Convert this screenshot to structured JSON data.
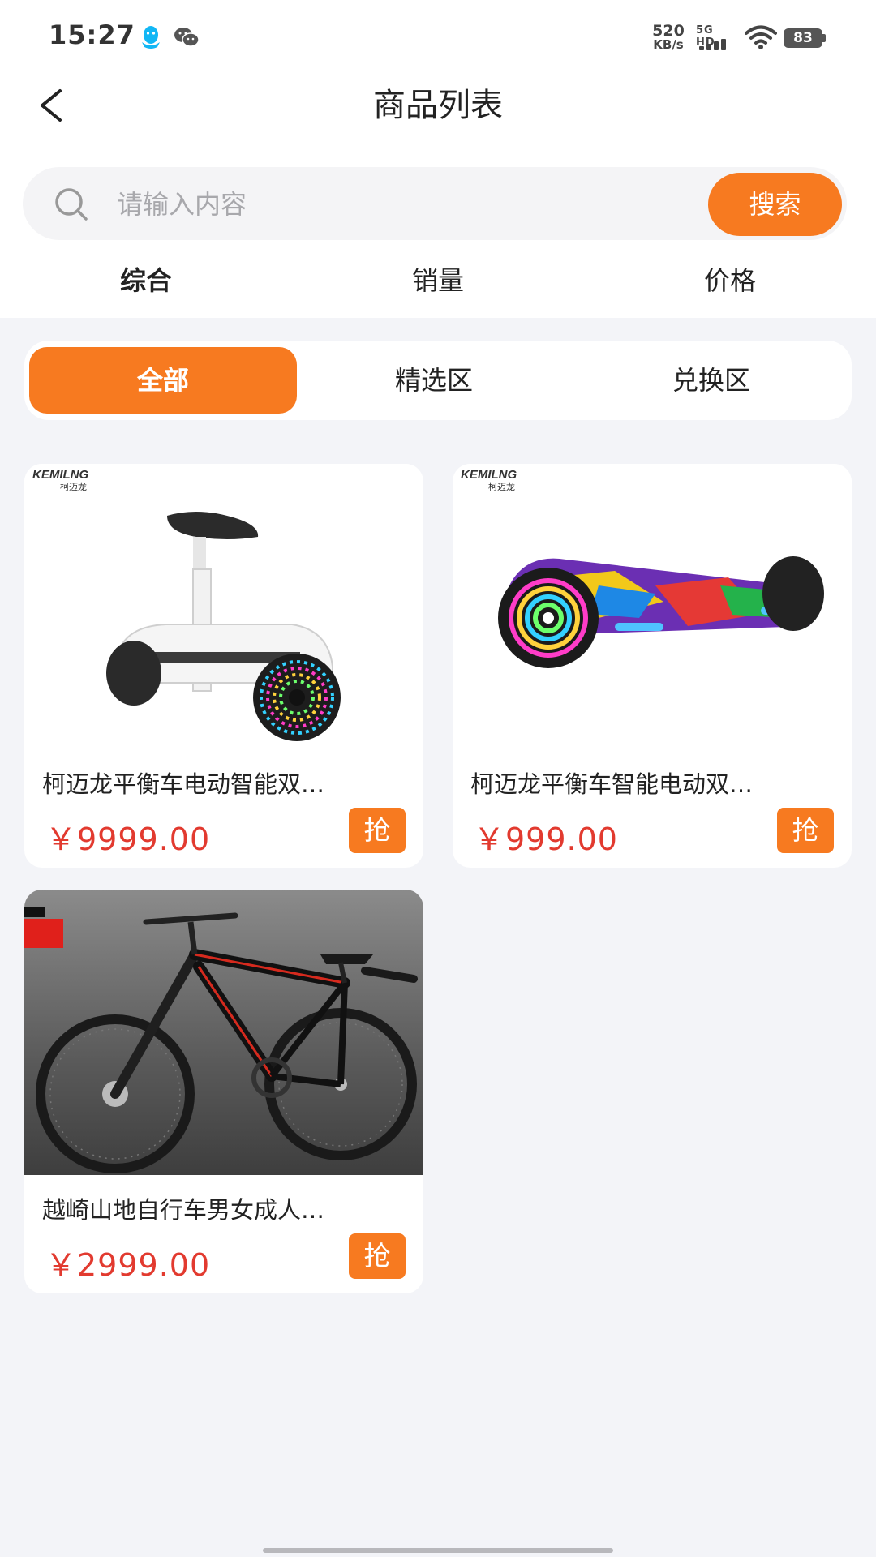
{
  "status_bar": {
    "time": "15:27",
    "net_speed_value": "520",
    "net_speed_unit": "KB/s",
    "network_label": "5G HD",
    "battery_level": "83",
    "icons": [
      "qq-icon",
      "wechat-icon",
      "signal-icon",
      "wifi-icon",
      "battery-icon"
    ]
  },
  "header": {
    "title": "商品列表",
    "back_icon": "chevron-left-icon"
  },
  "search": {
    "placeholder": "请输入内容",
    "value": "",
    "button_label": "搜索",
    "icon": "search-icon"
  },
  "sort_tabs": [
    {
      "label": "综合",
      "active": true
    },
    {
      "label": "销量",
      "active": false
    },
    {
      "label": "价格",
      "active": false
    }
  ],
  "segments": [
    {
      "label": "全部",
      "active": true
    },
    {
      "label": "精选区",
      "active": false
    },
    {
      "label": "兑换区",
      "active": false
    }
  ],
  "products": [
    {
      "name": "柯迈龙平衡车电动智能双…",
      "price": "￥9999.00",
      "buy_label": "抢",
      "image_brand": "KEMILNG 柯迈龙"
    },
    {
      "name": "柯迈龙平衡车智能电动双…",
      "price": "￥999.00",
      "buy_label": "抢",
      "image_brand": "KEMILNG 柯迈龙"
    },
    {
      "name": "越崎山地自行车男女成人…",
      "price": "￥2999.00",
      "buy_label": "抢",
      "image_brand": ""
    }
  ],
  "colors": {
    "accent": "#f77a20",
    "price": "#e23a2f",
    "background": "#f3f4f8"
  }
}
